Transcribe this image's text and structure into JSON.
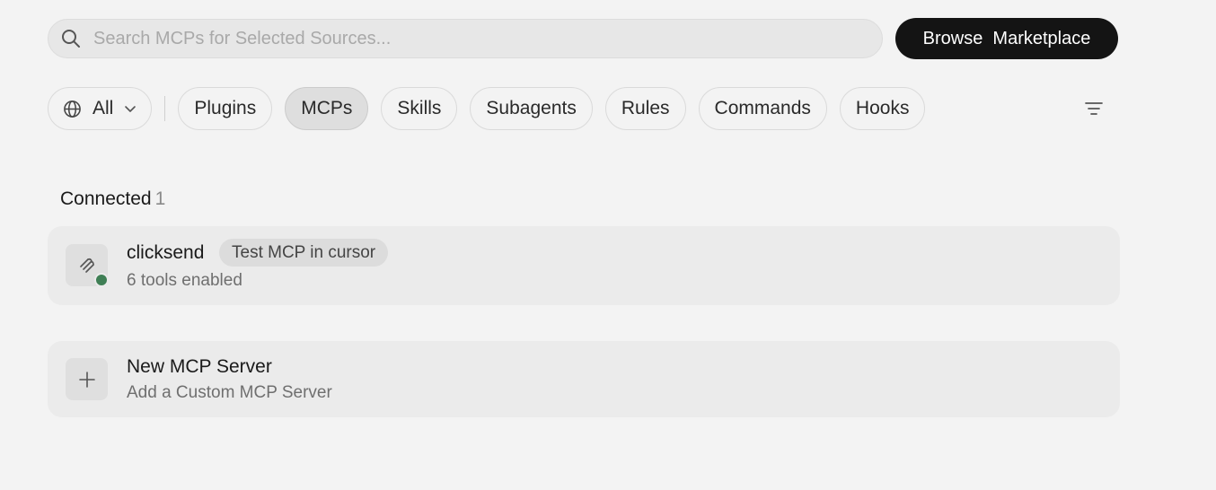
{
  "search": {
    "placeholder": "Search MCPs for Selected Sources...",
    "value": ""
  },
  "browse_button": {
    "label": "Browse  Marketplace"
  },
  "filters": {
    "scope": "All",
    "chips": [
      {
        "label": "Plugins",
        "active": false
      },
      {
        "label": "MCPs",
        "active": true
      },
      {
        "label": "Skills",
        "active": false
      },
      {
        "label": "Subagents",
        "active": false
      },
      {
        "label": "Rules",
        "active": false
      },
      {
        "label": "Commands",
        "active": false
      },
      {
        "label": "Hooks",
        "active": false
      }
    ]
  },
  "section": {
    "title": "Connected",
    "count": "1"
  },
  "servers": [
    {
      "name": "clicksend",
      "badge": "Test MCP in cursor",
      "subtitle": "6 tools enabled",
      "status_color": "#3f7f55"
    }
  ],
  "new_server": {
    "title": "New MCP Server",
    "subtitle": "Add a Custom MCP Server"
  },
  "icons": {
    "search": "search-icon",
    "globe": "globe-icon",
    "chevron": "chevron-down-icon",
    "filter": "filter-icon",
    "server": "mcp-server-icon",
    "plus": "plus-icon"
  },
  "colors": {
    "background": "#f3f3f3",
    "primary_button": "#141414",
    "status_connected": "#3f7f55"
  }
}
